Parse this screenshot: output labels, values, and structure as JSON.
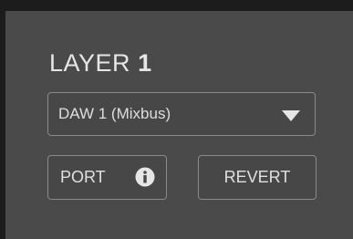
{
  "layer": {
    "title_prefix": "LAYER",
    "title_number": "1"
  },
  "source_select": {
    "value": "DAW 1 (Mixbus)",
    "icon": "triangle-down-icon"
  },
  "buttons": {
    "port_label": "PORT",
    "port_icon": "info-icon",
    "revert_label": "REVERT"
  },
  "colors": {
    "background": "#1c1c1c",
    "panel": "#4a4a4a",
    "border": "#8a8a8a",
    "text": "#e6e6e6"
  }
}
